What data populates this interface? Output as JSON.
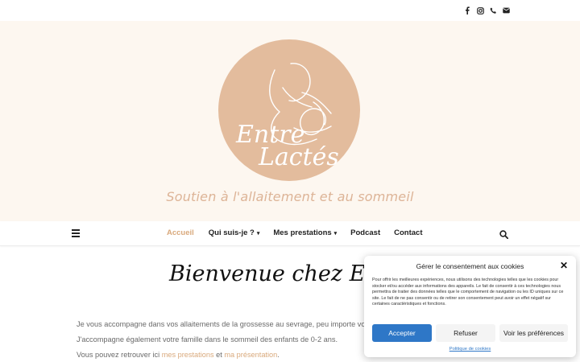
{
  "topbar": {
    "social": [
      {
        "icon": "facebook-icon",
        "glyph": "f"
      },
      {
        "icon": "instagram-icon",
        "glyph": "◎"
      },
      {
        "icon": "phone-icon",
        "glyph": "✆"
      },
      {
        "icon": "mail-icon",
        "glyph": "✉"
      }
    ]
  },
  "hero": {
    "logo_line1": "Entre",
    "logo_line2": "Lactés",
    "tagline": "Soutien à l'allaitement et au sommeil",
    "colors": {
      "background": "#fdf7f0",
      "logo_circle": "#e3bc9d",
      "tagline": "#ddb497"
    }
  },
  "nav": {
    "items": [
      {
        "label": "Accueil",
        "active": true
      },
      {
        "label": "Qui suis-je ?",
        "dropdown": true
      },
      {
        "label": "Mes prestations",
        "dropdown": true
      },
      {
        "label": "Podcast"
      },
      {
        "label": "Contact"
      }
    ],
    "chevron": "⌄",
    "accent": "#d9a97c"
  },
  "main": {
    "welcome": "Bienvenue chez EntreLa",
    "p1": "Je vous accompagne dans vos allaitements de la grossesse au sevrage, peu importe vos proje",
    "p2": "J'accompagne également votre famille dans le sommeil des enfants de 0-2 ans.",
    "p3_before": "Vous pouvez retrouver ici ",
    "p3_link1": "mes prestations",
    "p3_mid": " et ",
    "p3_link2": "ma présentation",
    "p3_after": "."
  },
  "cookie": {
    "title": "Gérer le consentement aux cookies",
    "close": "✕",
    "text": "Pour offrir les meilleures expériences, nous utilisons des technologies telles que les cookies pour stocker et/ou accéder aux informations des appareils. Le fait de consentir à ces technologies nous permettra de traiter des données telles que le comportement de navigation ou les ID uniques sur ce site. Le fait de ne pas consentir ou de retirer son consentement peut avoir un effet négatif sur certaines caractéristiques et fonctions.",
    "accept": "Accepter",
    "refuse": "Refuser",
    "prefs": "Voir les préférences",
    "policy": "Politique de cookies",
    "accent": "#2e77c7"
  }
}
